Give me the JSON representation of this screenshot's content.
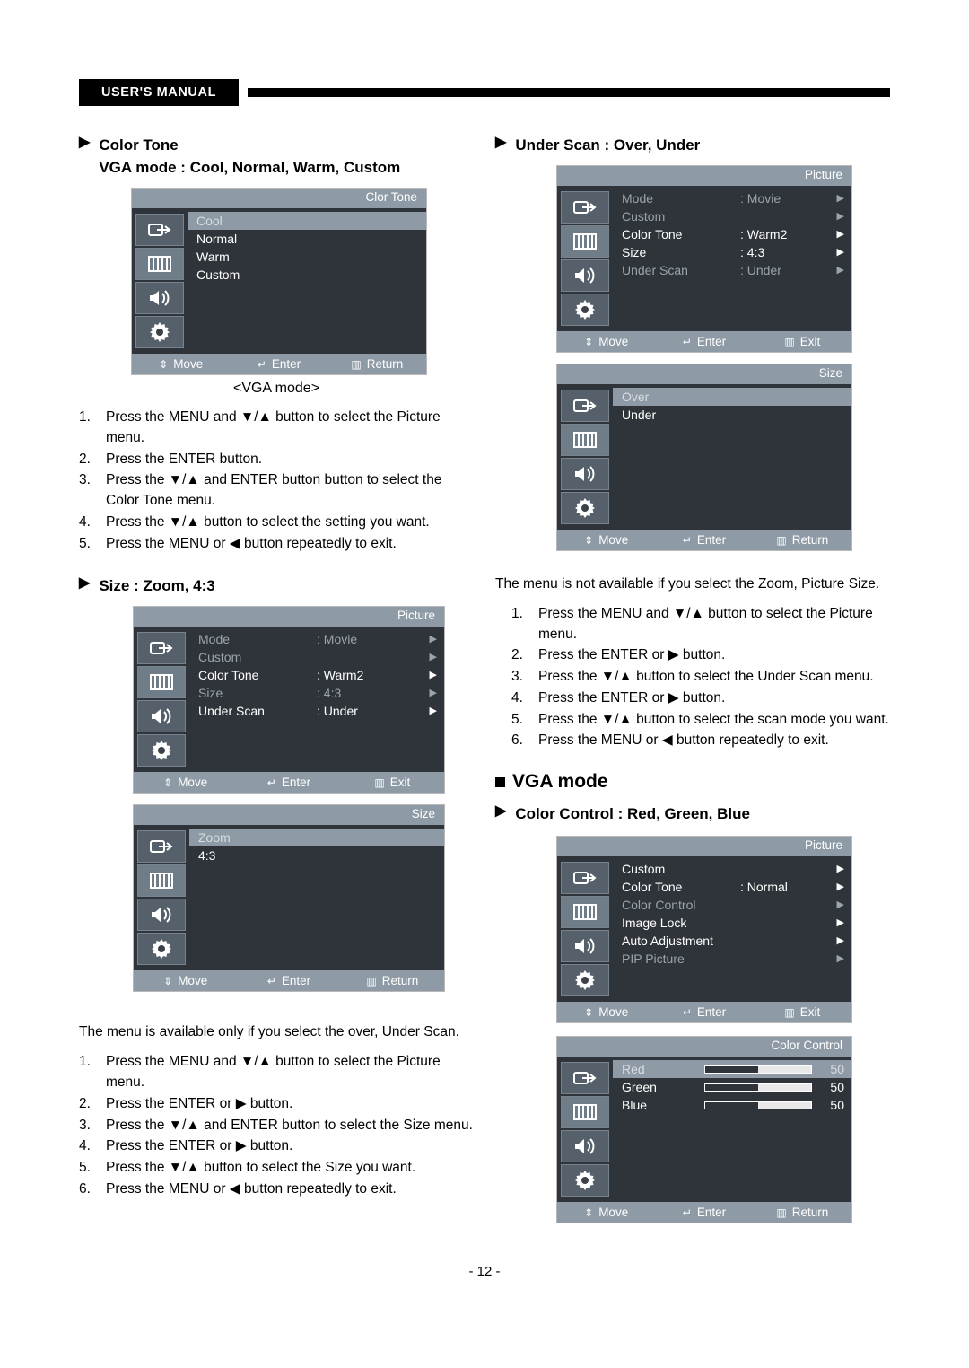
{
  "header": {
    "tag": "USER'S MANUAL"
  },
  "page_number": "- 12 -",
  "left": {
    "sec1": {
      "title": "Color Tone",
      "subtitle": "VGA mode : Cool, Normal, Warm, Custom",
      "caption": "<VGA mode>",
      "osd": {
        "title": "Clor Tone",
        "items": [
          "Cool",
          "Normal",
          "Warm",
          "Custom"
        ],
        "footer": [
          "Move",
          "Enter",
          "Return"
        ]
      },
      "steps": [
        {
          "num": "1.",
          "text": "Press the MENU and ▼/▲ button to select the Picture menu."
        },
        {
          "num": "2.",
          "text": "Press  the ENTER button."
        },
        {
          "num": "3.",
          "text": "Press  the ▼/▲ and ENTER button button to select the Color Tone menu."
        },
        {
          "num": "4.",
          "text": "Press the ▼/▲ button to select the setting you want."
        },
        {
          "num": "5.",
          "text": "Press the MENU or ◀ button repeatedly to exit."
        }
      ]
    },
    "sec2": {
      "title": "Size : Zoom, 4:3",
      "osd1": {
        "title": "Picture",
        "rows": [
          {
            "label": "Mode",
            "value": ": Movie",
            "dim": true,
            "arrow": "▶"
          },
          {
            "label": "Custom",
            "value": "",
            "dim": true,
            "arrow": "▶"
          },
          {
            "label": "Color Tone",
            "value": ": Warm2",
            "dim": false,
            "arrow": "▶"
          },
          {
            "label": "Size",
            "value": ": 4:3",
            "dim": true,
            "arrow": "▶"
          },
          {
            "label": "Under Scan",
            "value": ": Under",
            "dim": false,
            "arrow": "▶"
          }
        ],
        "footer": [
          "Move",
          "Enter",
          "Exit"
        ]
      },
      "osd2": {
        "title": "Size",
        "items": [
          "Zoom",
          "4:3"
        ],
        "footer": [
          "Move",
          "Enter",
          "Return"
        ]
      },
      "note": "The menu is available only if you select the over, Under Scan.",
      "steps": [
        {
          "num": "1.",
          "text": "Press the MENU and ▼/▲ button to select the Picture menu."
        },
        {
          "num": "2.",
          "text": "Press  the ENTER or ▶ button."
        },
        {
          "num": "3.",
          "text": "Press  the ▼/▲ and ENTER button to select the Size menu."
        },
        {
          "num": "4.",
          "text": "Press  the ENTER or ▶ button."
        },
        {
          "num": "5.",
          "text": "Press the ▼/▲ button to select the Size you want."
        },
        {
          "num": "6.",
          "text": "Press the MENU or ◀ button repeatedly to exit."
        }
      ]
    }
  },
  "right": {
    "sec1": {
      "title": "Under Scan : Over, Under",
      "osd1": {
        "title": "Picture",
        "rows": [
          {
            "label": "Mode",
            "value": ": Movie",
            "dim": true,
            "arrow": "▶"
          },
          {
            "label": "Custom",
            "value": "",
            "dim": true,
            "arrow": "▶"
          },
          {
            "label": "Color Tone",
            "value": ": Warm2",
            "dim": false,
            "arrow": "▶"
          },
          {
            "label": "Size",
            "value": ": 4:3",
            "dim": false,
            "arrow": "▶"
          },
          {
            "label": "Under Scan",
            "value": ": Under",
            "dim": true,
            "arrow": "▶"
          }
        ],
        "footer": [
          "Move",
          "Enter",
          "Exit"
        ]
      },
      "osd2": {
        "title": "Size",
        "items": [
          "Over",
          "Under"
        ],
        "footer": [
          "Move",
          "Enter",
          "Return"
        ]
      },
      "note": "The menu is not available if you select the Zoom, Picture Size.",
      "steps": [
        {
          "num": "1.",
          "text": "Press the MENU and ▼/▲ button to select the Picture menu."
        },
        {
          "num": "2.",
          "text": "Press  the ENTER or ▶ button."
        },
        {
          "num": "3.",
          "text": "Press  the ▼/▲ button to select the Under Scan menu."
        },
        {
          "num": "4.",
          "text": "Press  the ENTER or ▶ button."
        },
        {
          "num": "5.",
          "text": "Press the ▼/▲ button to select the scan mode you want."
        },
        {
          "num": "6.",
          "text": "Press the MENU or ◀ button repeatedly to exit."
        }
      ]
    },
    "sec2": {
      "heading": "VGA mode",
      "title": "Color Control : Red, Green, Blue",
      "osd1": {
        "title": "Picture",
        "rows": [
          {
            "label": "Custom",
            "value": "",
            "dim": false,
            "arrow": "▶"
          },
          {
            "label": "Color Tone",
            "value": ": Normal",
            "dim": false,
            "arrow": "▶"
          },
          {
            "label": "Color Control",
            "value": "",
            "dim": true,
            "arrow": "▶"
          },
          {
            "label": "Image Lock",
            "value": "",
            "dim": false,
            "arrow": "▶"
          },
          {
            "label": "Auto Adjustment",
            "value": "",
            "dim": false,
            "arrow": "▶"
          },
          {
            "label": "PIP Picture",
            "value": "",
            "dim": true,
            "arrow": "▶"
          }
        ],
        "footer": [
          "Move",
          "Enter",
          "Exit"
        ]
      },
      "osd2": {
        "title": "Color Control",
        "sliders": [
          {
            "label": "Red",
            "value": "50",
            "pct": 50,
            "hl": true
          },
          {
            "label": "Green",
            "value": "50",
            "pct": 50,
            "hl": false
          },
          {
            "label": "Blue",
            "value": "50",
            "pct": 50,
            "hl": false
          }
        ],
        "footer": [
          "Move",
          "Enter",
          "Return"
        ]
      }
    }
  },
  "icons": {
    "input": "input-source-icon",
    "picture": "picture-icon",
    "sound": "speaker-icon",
    "setup": "gear-icon",
    "move": "up-down-arrow-icon",
    "enter": "enter-icon",
    "exit": "exit-icon",
    "return": "return-icon"
  }
}
